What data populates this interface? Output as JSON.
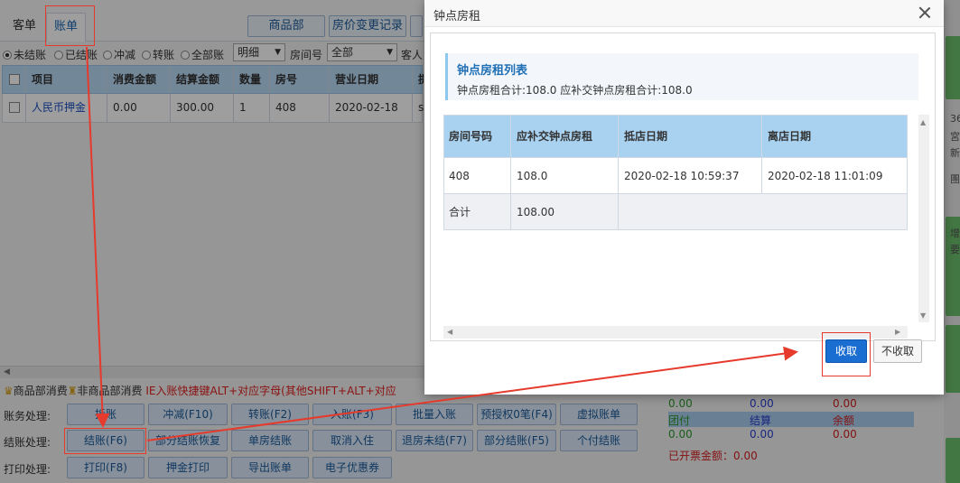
{
  "app": {
    "tabs": [
      "客单",
      "账单"
    ],
    "top_buttons": [
      "商品部",
      "房价变更记录"
    ],
    "filter_radios": [
      "未结账",
      "已结账",
      "冲减",
      "转账",
      "全部账"
    ],
    "detail_select": "明细",
    "room_no_label": "房间号",
    "room_select": "全部",
    "guest_label": "客人",
    "grid": {
      "headers": [
        "项目",
        "消费金额",
        "结算金额",
        "数量",
        "房号",
        "营业日期",
        "提"
      ],
      "row": [
        "人民币押金",
        "0.00",
        "300.00",
        "1",
        "408",
        "2020-02-18",
        "s"
      ]
    },
    "legend": {
      "goods": "商品部消费",
      "non_goods": "非商品部消费",
      "hint": "IE入账快捷键ALT+对应字母(其他SHIFT+ALT+对应"
    },
    "rows": [
      {
        "label": "账务处理:",
        "buttons": [
          "拆账",
          "冲减(F10)",
          "转账(F2)",
          "入账(F3)",
          "批量入账",
          "预授权0笔(F4)",
          "虚拟账单"
        ]
      },
      {
        "label": "结账处理:",
        "buttons": [
          "结账(F6)",
          "部分结账恢复",
          "单房结账",
          "取消入住",
          "退房未结(F7)",
          "部分结账(F5)",
          "个付结账"
        ]
      },
      {
        "label": "打印处理:",
        "buttons": [
          "打印(F8)",
          "押金打印",
          "导出账单",
          "电子优惠券"
        ]
      }
    ],
    "totals": {
      "top": [
        "0.00",
        "0.00",
        "0.00"
      ],
      "labels": [
        "团付",
        "结算",
        "余额"
      ],
      "bottom": [
        "0.00",
        "0.00",
        "0.00"
      ],
      "invoice": "已开票金额：0.00"
    },
    "right_strip": [
      "36",
      "宮",
      "新",
      "團",
      "增",
      "要"
    ]
  },
  "dialog": {
    "title": "钟点房租",
    "list_title": "钟点房租列表",
    "summary": "钟点房租合计:108.0 应补交钟点房租合计:108.0",
    "headers": [
      "房间号码",
      "应补交钟点房租",
      "抵店日期",
      "离店日期"
    ],
    "row": [
      "408",
      "108.0",
      "2020-02-18 10:59:37",
      "2020-02-18 11:01:09"
    ],
    "total_row": [
      "合计",
      "108.00"
    ],
    "confirm_label": "收取",
    "cancel_label": "不收取"
  },
  "colors": {
    "accent": "#1b6ed1",
    "header_bg": "#a9d2f1",
    "annotation": "#e53a2c",
    "goods_icon": "#d4a017"
  }
}
